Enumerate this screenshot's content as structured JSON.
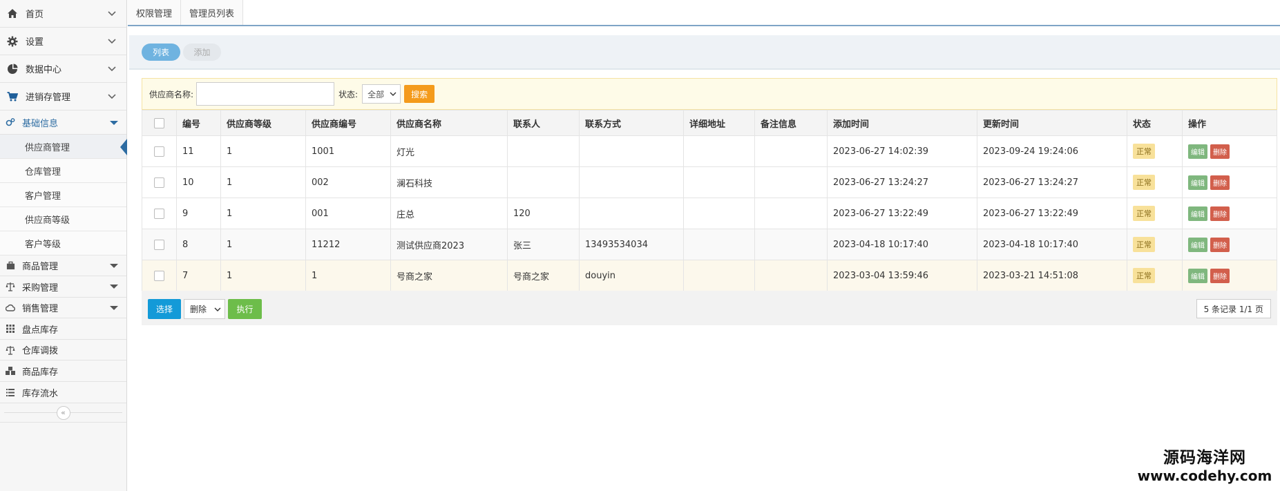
{
  "sidebar": {
    "top": [
      {
        "label": "首页",
        "icon": "home-icon"
      },
      {
        "label": "设置",
        "icon": "gear-icon"
      },
      {
        "label": "数据中心",
        "icon": "pie-chart-icon"
      },
      {
        "label": "进销存管理",
        "icon": "cart-icon"
      }
    ],
    "groups": [
      {
        "label": "基础信息",
        "icon": "cogs-icon",
        "children": [
          "供应商管理",
          "仓库管理",
          "客户管理",
          "供应商等级",
          "客户等级"
        ]
      },
      {
        "label": "商品管理",
        "icon": "briefcase-icon"
      },
      {
        "label": "采购管理",
        "icon": "scale-icon"
      },
      {
        "label": "销售管理",
        "icon": "cloud-icon"
      },
      {
        "label": "盘点库存",
        "icon": "grid-icon"
      },
      {
        "label": "仓库调拨",
        "icon": "scale-icon"
      },
      {
        "label": "商品库存",
        "icon": "cubes-icon"
      },
      {
        "label": "库存流水",
        "icon": "list-icon"
      }
    ],
    "collapse_glyph": "«"
  },
  "topbar": {
    "tabs": [
      "权限管理",
      "管理员列表"
    ]
  },
  "subtabs": {
    "list": "列表",
    "add": "添加"
  },
  "search": {
    "supplier_label": "供应商名称:",
    "status_label": "状态:",
    "status_value": "全部",
    "button": "搜索"
  },
  "table": {
    "headers": [
      "编号",
      "供应商等级",
      "供应商编号",
      "供应商名称",
      "联系人",
      "联系方式",
      "详细地址",
      "备注信息",
      "添加时间",
      "更新时间",
      "状态",
      "操作"
    ],
    "rows": [
      {
        "id": "11",
        "level": "1",
        "code": "1001",
        "name": "灯光",
        "contact": "",
        "phone": "",
        "address": "",
        "note": "",
        "added": "2023-06-27 14:02:39",
        "updated": "2023-09-24 19:24:06",
        "status": "正常"
      },
      {
        "id": "10",
        "level": "1",
        "code": "002",
        "name": "澜石科技",
        "contact": "",
        "phone": "",
        "address": "",
        "note": "",
        "added": "2023-06-27 13:24:27",
        "updated": "2023-06-27 13:24:27",
        "status": "正常"
      },
      {
        "id": "9",
        "level": "1",
        "code": "001",
        "name": "庄总",
        "contact": "120",
        "phone": "",
        "address": "",
        "note": "",
        "added": "2023-06-27 13:22:49",
        "updated": "2023-06-27 13:22:49",
        "status": "正常"
      },
      {
        "id": "8",
        "level": "1",
        "code": "11212",
        "name": "测试供应商2023",
        "contact": "张三",
        "phone": "13493534034",
        "address": "",
        "note": "",
        "added": "2023-04-18 10:17:40",
        "updated": "2023-04-18 10:17:40",
        "status": "正常"
      },
      {
        "id": "7",
        "level": "1",
        "code": "1",
        "name": "号商之家",
        "contact": "号商之家",
        "phone": "douyin",
        "address": "",
        "note": "",
        "added": "2023-03-04 13:59:46",
        "updated": "2023-03-21 14:51:08",
        "status": "正常"
      }
    ],
    "edit_label": "编辑",
    "delete_label": "删除"
  },
  "footer": {
    "select_button": "选择",
    "action_value": "删除",
    "execute_button": "执行",
    "pager": "5 条记录 1/1 页"
  },
  "watermark": {
    "line1": "源码海洋网",
    "line2": "www.codehy.com"
  }
}
